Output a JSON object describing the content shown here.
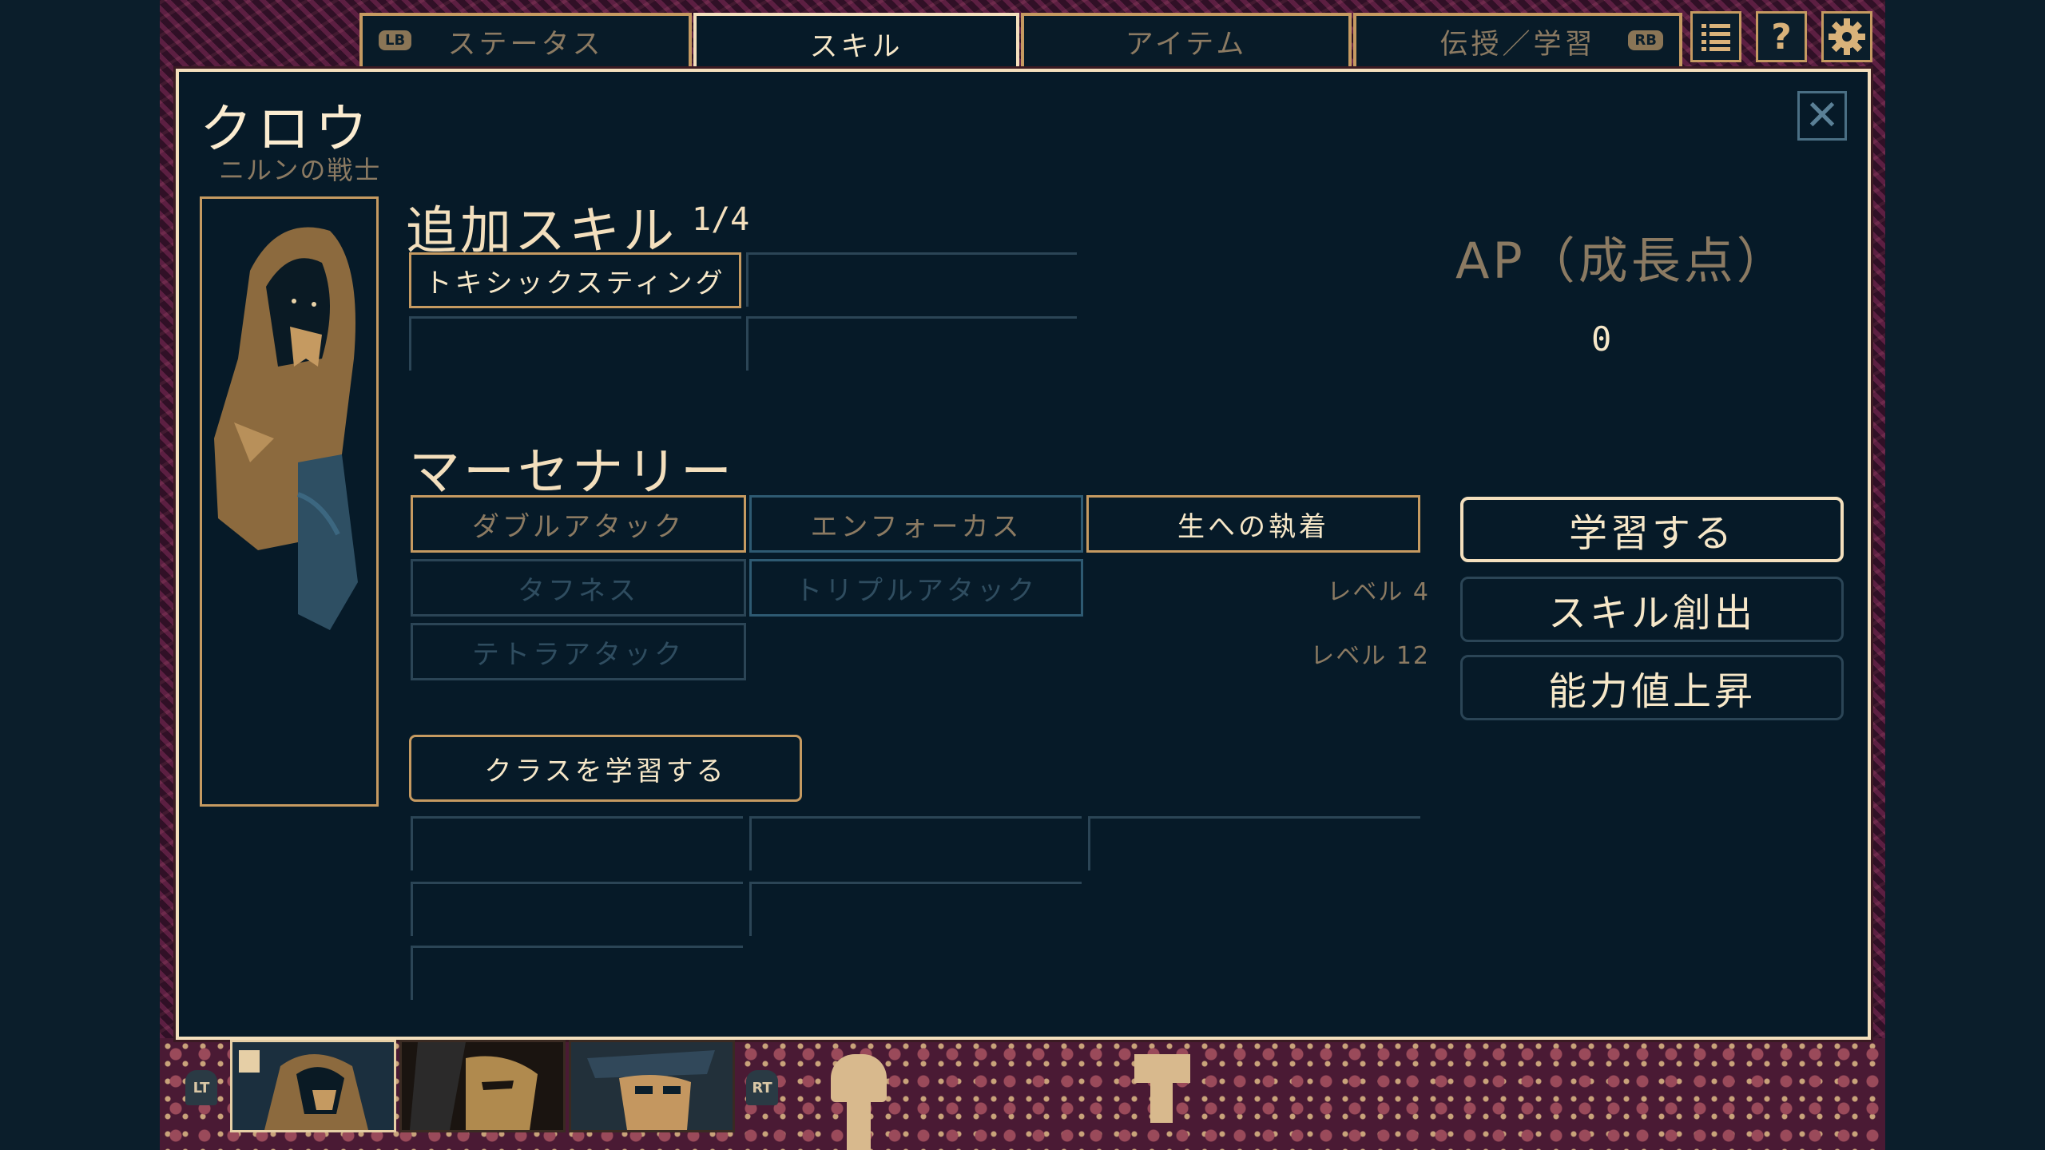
{
  "tabs": [
    {
      "label": "ステータス",
      "badge": "LB"
    },
    {
      "label": "スキル"
    },
    {
      "label": "アイテム"
    },
    {
      "label": "伝授／学習",
      "badge": "RB"
    }
  ],
  "top_icons": [
    "list-icon",
    "help-icon",
    "gear-icon"
  ],
  "character": {
    "name": "クロウ",
    "subtitle": "ニルンの戦士"
  },
  "extra_skills": {
    "title": "追加スキル",
    "count": "1/4",
    "slots": [
      "トキシックスティング",
      "",
      "",
      ""
    ]
  },
  "class_section": {
    "title": "マーセナリー",
    "skills": [
      {
        "label": "ダブルアタック",
        "state": "learned"
      },
      {
        "label": "エンフォーカス",
        "state": "learned"
      },
      {
        "label": "生への執着",
        "state": "equipped"
      },
      {
        "label": "タフネス",
        "state": "locked"
      },
      {
        "label": "トリプルアタック",
        "state": "locked"
      },
      {
        "label": "テトラアタック",
        "state": "locked"
      }
    ],
    "levels": [
      "レベル 4",
      "レベル 12"
    ]
  },
  "learn_class_button": "クラスを学習する",
  "ap": {
    "title": "AP（成長点）",
    "value": "0"
  },
  "actions": [
    {
      "label": "学習する",
      "selected": true
    },
    {
      "label": "スキル創出",
      "selected": false
    },
    {
      "label": "能力値上昇",
      "selected": false
    }
  ],
  "party": {
    "left_trigger": "LT",
    "right_trigger": "RT"
  },
  "colors": {
    "accent": "#c59a61",
    "panel": "#061a28",
    "text": "#f6e7c8",
    "dim": "#8b7a62"
  }
}
